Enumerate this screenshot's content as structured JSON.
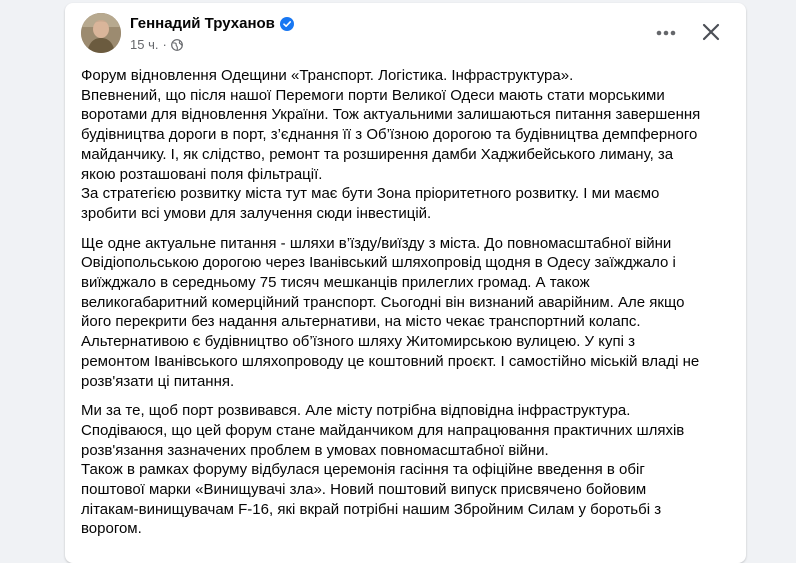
{
  "post": {
    "author": "Геннадий Труханов",
    "verified": true,
    "time": "15 ч.",
    "separator": "·",
    "audience_icon": "globe-icon",
    "more_icon": "more-horizontal-icon",
    "close_icon": "close-icon",
    "paragraphs": [
      {
        "lines": [
          "Форум відновлення Одещини «Транспорт. Логістика. Інфраструктура».",
          "Впевнений, що після нашої Перемоги порти Великої Одеси мають стати морськими",
          "воротами для відновлення України. Тож актуальними залишаються питання завершення",
          "будівництва дороги в порт, з’єднання її з Об’їзною дорогою та будівництва демпферного",
          "майданчику. І, як слідство, ремонт та розширення дамби Хаджибейського лиману, за",
          "якою розташовані поля фільтрації.",
          "За стратегією розвитку міста тут має бути Зона пріоритетного розвитку. І ми маємо",
          "зробити всі умови для залучення сюди інвестицій."
        ]
      },
      {
        "lines": [
          "Ще одне актуальне питання - шляхи в’їзду/виїзду з міста. До повномасштабної війни",
          "Овідіопольською дорогою через Іванівський шляхопровід щодня в Одесу заїжджало і",
          "виїжджало в середньому 75 тисяч мешканців прилеглих громад. А також",
          "великогабаритний комерційний транспорт. Сьогодні він визнаний аварійним. Але якщо",
          "його перекрити без надання альтернативи, на місто чекає транспортний колапс.",
          "Альтернативою є будівництво об’їзного шляху Житомирською вулицею. У купі з",
          "ремонтом Іванівського шляхопроводу це коштовний проєкт. І самостійно міській владі не",
          "розв'язати ці питання."
        ]
      },
      {
        "lines": [
          "Ми за те, щоб порт розвивався. Але місту потрібна відповідна інфраструктура.",
          "Сподіваюся, що цей форум стане майданчиком для напрацювання практичних шляхів",
          "розв'язання зазначених проблем в умовах повномасштабної війни.",
          "Також в рамках форуму відбулася церемонія гасіння та офіційне введення в обіг",
          "поштової марки «Винищувачі зла». Новий поштовий випуск присвячено бойовим",
          "літакам-винищувачам F-16, які вкрай потрібні нашим Збройним Силам у боротьбі з",
          "ворогом."
        ]
      }
    ]
  }
}
